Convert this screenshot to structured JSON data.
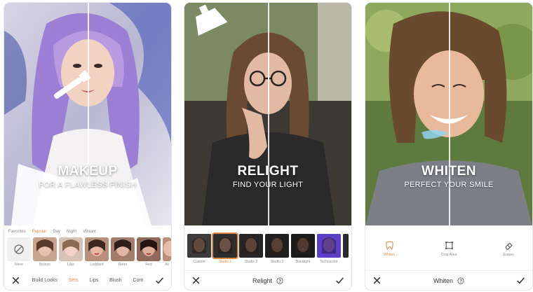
{
  "colors": {
    "accent": "#e08a4a"
  },
  "panels": [
    {
      "headline": "MAKEUP",
      "subline": "FOR A FLAWLESS FINISH",
      "categories": [
        "Favorites",
        "Popular",
        "Day",
        "Night",
        "Vibrant"
      ],
      "looks": [
        "None",
        "Bronze",
        "Lilac",
        "Ladybird",
        "Retro",
        "Red",
        "Ali"
      ],
      "tabs": [
        "Build Looks",
        "Sets",
        "Lips",
        "Blush",
        "Cont"
      ]
    },
    {
      "headline": "RELIGHT",
      "subline": "FIND YOUR LIGHT",
      "presets": [
        "Custom",
        "Studio 1",
        "Studio 2",
        "Studio 3",
        "Backlight",
        "Technicolor"
      ],
      "tool_label": "Relight"
    },
    {
      "headline": "WHITEN",
      "subline": "PERFECT YOUR SMILE",
      "tools": [
        "Whiten",
        "Crop Area",
        "Eraser"
      ],
      "tool_label": "Whiten"
    }
  ]
}
